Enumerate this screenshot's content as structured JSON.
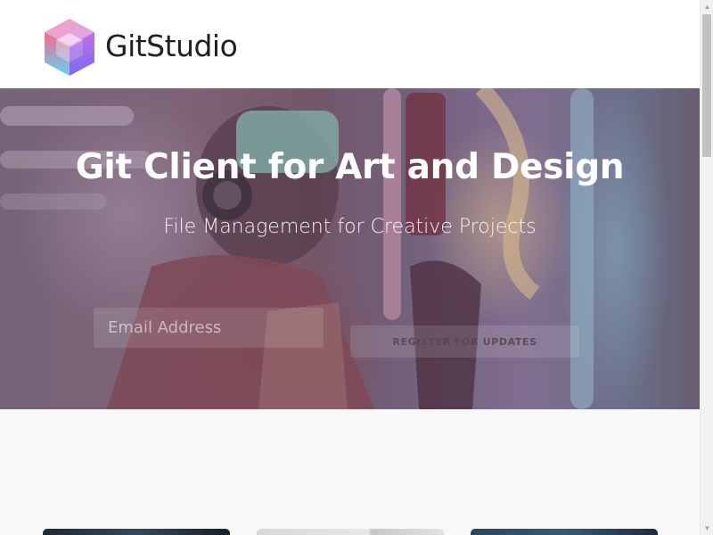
{
  "header": {
    "brand": "GitStudio",
    "logo_icon": "gitstudio-cube-logo"
  },
  "hero": {
    "title": "Git Client for Art and Design",
    "subtitle": "File Management for Creative Projects",
    "email_placeholder": "Email Address",
    "register_label": "REGISTER FOR UPDATES"
  },
  "cards": [
    {
      "name": "feature-card-1"
    },
    {
      "name": "feature-card-2"
    },
    {
      "name": "feature-card-3"
    }
  ],
  "colors": {
    "header_bg": "#ffffff",
    "page_bg": "#f8f8f8",
    "hero_text": "#ffffff",
    "logo_pink": "#f2658f",
    "logo_purple": "#8f6bf0",
    "logo_cyan": "#6fd6f2"
  }
}
